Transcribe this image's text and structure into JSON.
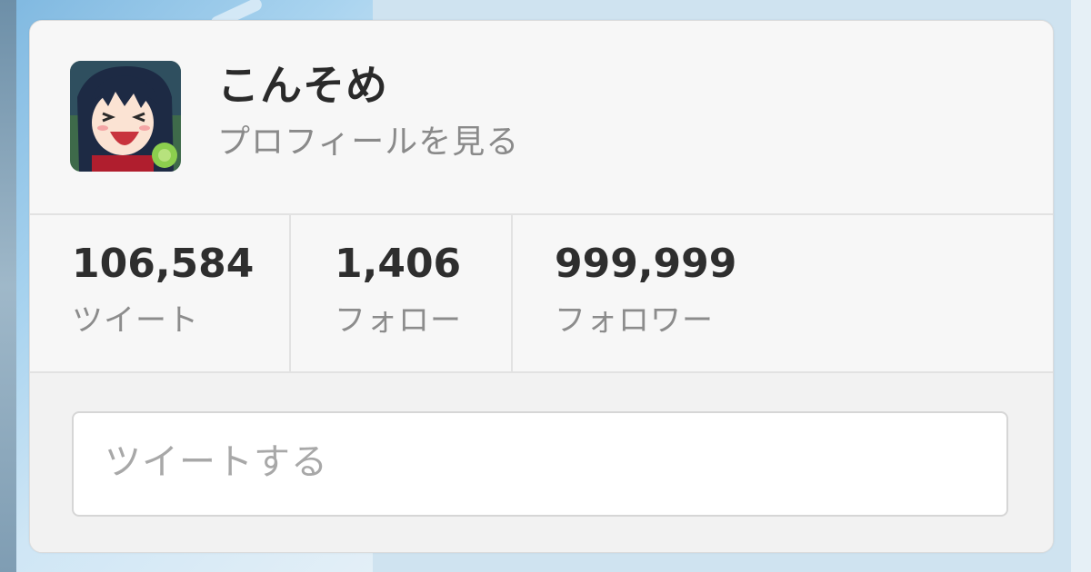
{
  "profile": {
    "name": "こんそめ",
    "view_profile_label": "プロフィールを見る"
  },
  "stats": [
    {
      "value": "106,584",
      "label": "ツイート"
    },
    {
      "value": "1,406",
      "label": "フォロー"
    },
    {
      "value": "999,999",
      "label": "フォロワー"
    }
  ],
  "compose": {
    "placeholder": "ツイートする"
  },
  "colors": {
    "background": "#d3e6f2",
    "card": "#f5f5f5",
    "name_text": "#2a2a2a",
    "muted_text": "#8a8a8a"
  }
}
